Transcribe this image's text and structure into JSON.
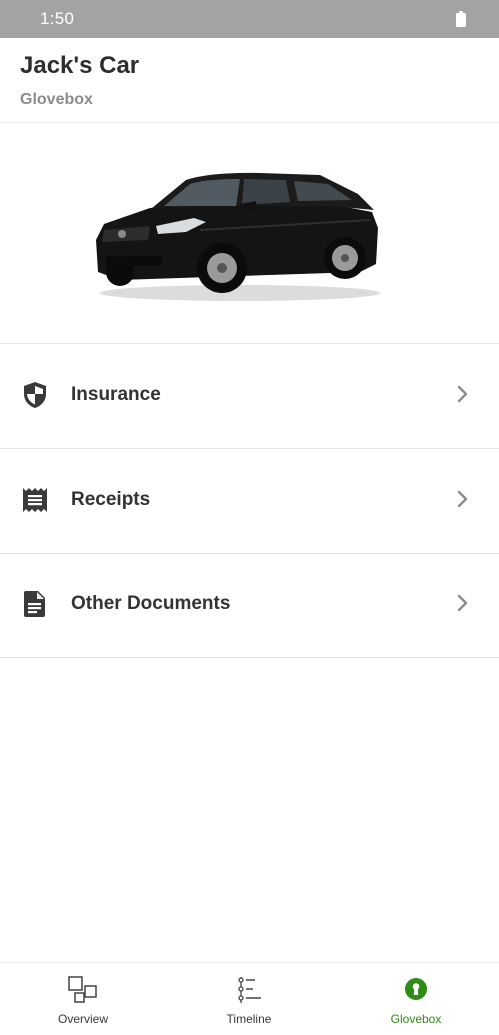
{
  "status_bar": {
    "time": "1:50",
    "battery_icon": "battery-full-icon"
  },
  "header": {
    "title": "Jack's Car",
    "subtitle": "Glovebox"
  },
  "car": {
    "image_name": "car-image",
    "color": "#111111"
  },
  "menu": [
    {
      "label": "Insurance",
      "icon": "shield-icon"
    },
    {
      "label": "Receipts",
      "icon": "receipt-icon"
    },
    {
      "label": "Other Documents",
      "icon": "document-icon"
    }
  ],
  "bottom_nav": {
    "active_color": "#2e8b14",
    "tabs": [
      {
        "label": "Overview",
        "icon": "overview-icon"
      },
      {
        "label": "Timeline",
        "icon": "timeline-icon"
      },
      {
        "label": "Glovebox",
        "icon": "keyhole-icon",
        "active": true
      }
    ]
  }
}
